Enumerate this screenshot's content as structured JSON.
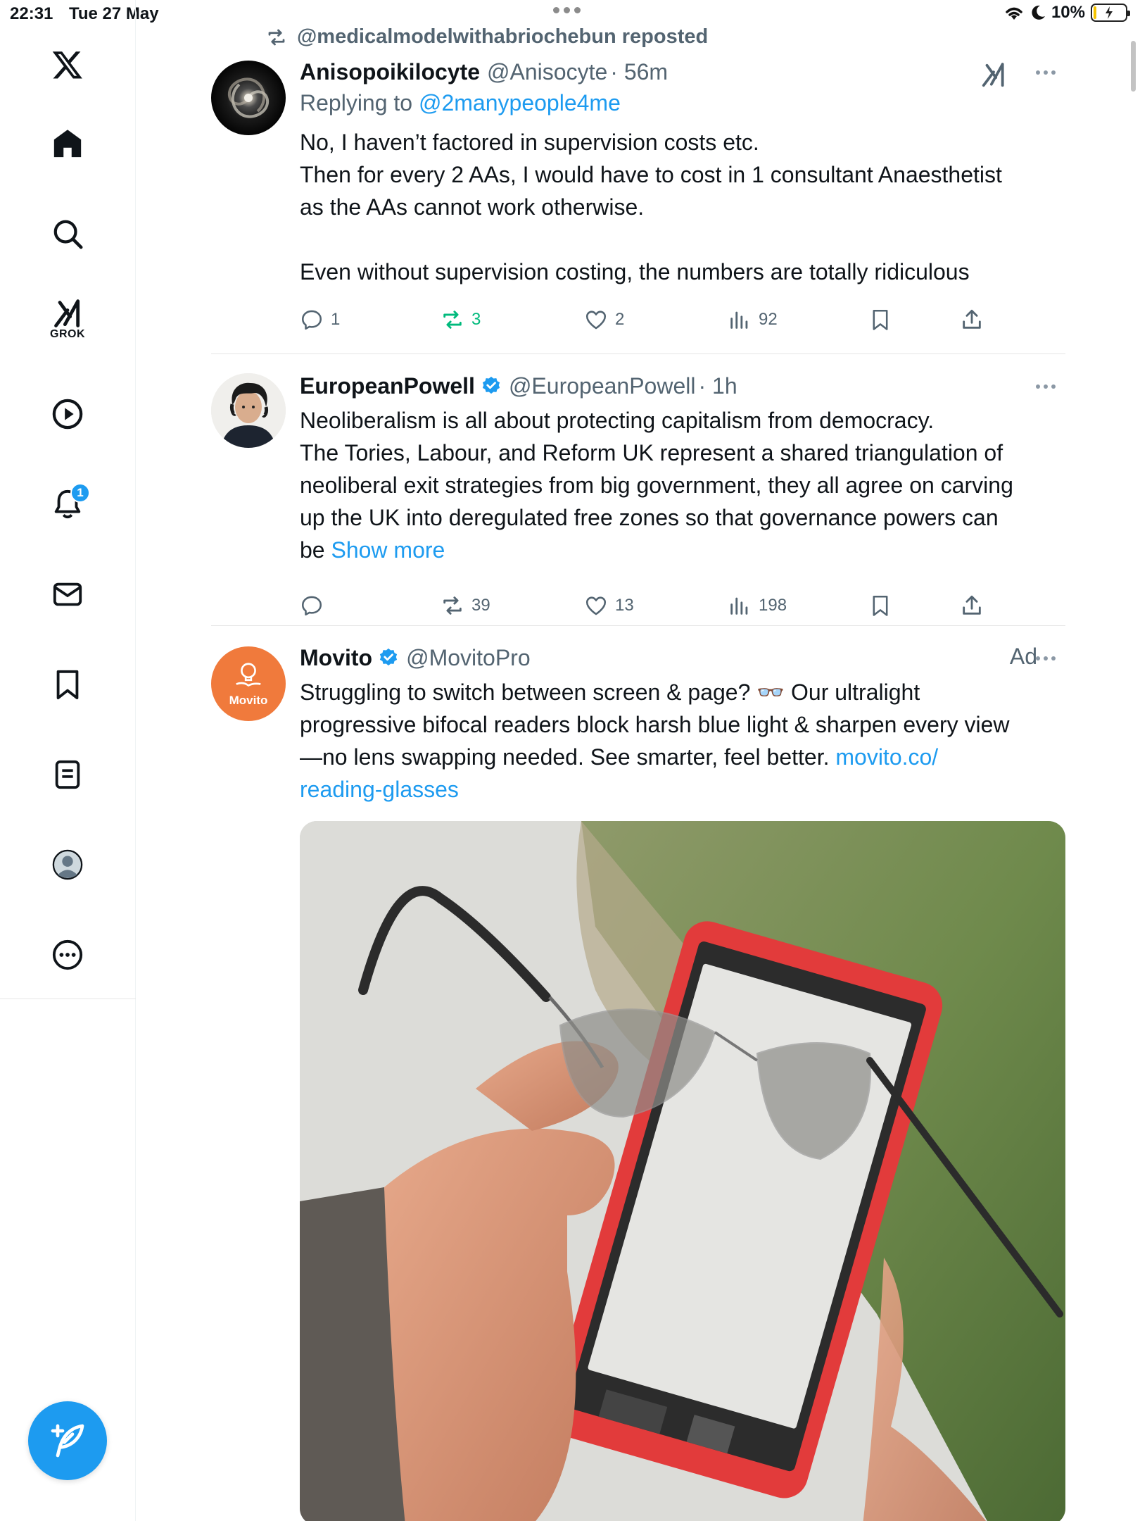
{
  "status_bar": {
    "time": "22:31",
    "date": "Tue 27 May",
    "battery": "10%",
    "battery_level": 0.1
  },
  "sidebar": {
    "items": [
      {
        "icon": "x-logo-icon",
        "label": ""
      },
      {
        "icon": "home-icon",
        "label": ""
      },
      {
        "icon": "search-icon",
        "label": ""
      },
      {
        "icon": "grok-icon",
        "label": "GROK"
      },
      {
        "icon": "play-icon",
        "label": ""
      },
      {
        "icon": "bell-icon",
        "label": "",
        "badge": "1"
      },
      {
        "icon": "mail-icon",
        "label": ""
      },
      {
        "icon": "bookmark-icon",
        "label": ""
      },
      {
        "icon": "lists-icon",
        "label": ""
      },
      {
        "icon": "profile-icon",
        "label": ""
      },
      {
        "icon": "more-circle-icon",
        "label": ""
      }
    ]
  },
  "feed": {
    "repost_line": "@medicalmodelwithabriochebun reposted",
    "tweets": [
      {
        "name": "Anisopoikilocyte",
        "handle": "@Anisocyte",
        "time": "· 56m",
        "reply_prefix": "Replying to",
        "reply_handle": "@2manypeople4me",
        "text": "No, I haven’t factored in supervision costs etc.\nThen for every 2 AAs, I would have to cost in 1 consultant Anaesthetist\nas the AAs cannot work otherwise.\n\nEven without supervision costing, the numbers are totally ridiculous",
        "replies": "1",
        "reposts": "3",
        "likes": "2",
        "views": "92"
      },
      {
        "name": "EuropeanPowell",
        "handle": "@EuropeanPowell",
        "time": "· 1h",
        "text": "Neoliberalism is all about protecting capitalism from democracy.\nThe Tories, Labour, and Reform UK represent a shared triangulation of\nneoliberal exit strategies from big government, they all agree on carving\nup the UK into deregulated free zones so that governance powers can\nbe ",
        "show_more": "Show more",
        "replies": "",
        "reposts": "39",
        "likes": "13",
        "views": "198"
      },
      {
        "name": "Movito",
        "handle": "@MovitoPro",
        "ad_label": "Ad",
        "avatar_text": "Movito",
        "text": "Struggling to switch between screen & page? 👓 Our ultralight\nprogressive bifocal readers block harsh blue light & sharpen every view\n—no lens swapping needed. See smarter, feel better. ",
        "link": "movito.co/\nreading-glasses"
      }
    ]
  },
  "colors": {
    "accent": "#1d9bf0",
    "repost_green": "#00ba7c",
    "muted": "#536471",
    "movito_orange": "#f07a3c"
  }
}
